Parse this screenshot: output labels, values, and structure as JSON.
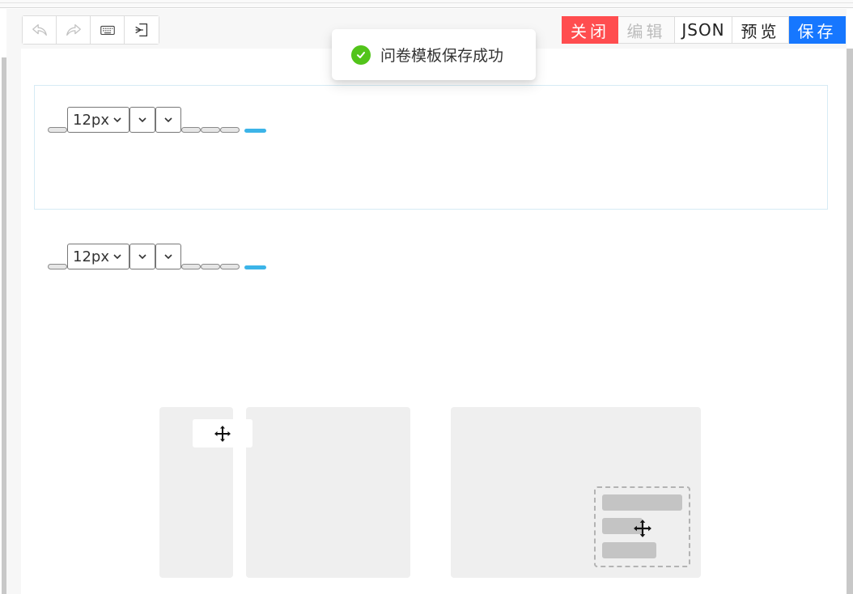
{
  "toolbar": {
    "undo_icon": "undo-icon",
    "redo_icon": "redo-icon",
    "keyboard_icon": "keyboard-icon",
    "import_icon": "import-icon"
  },
  "actions": {
    "close": "关闭",
    "edit": "编辑",
    "json": "JSON",
    "preview": "预览",
    "save": "保存"
  },
  "toast": {
    "message": "问卷模板保存成功",
    "icon": "check-circle-icon"
  },
  "rich_text": {
    "font_size": "12px"
  },
  "colors": {
    "close": "#ff4d4f",
    "save": "#1677ff",
    "success": "#52c41a",
    "accent": "#3cb4e8"
  }
}
